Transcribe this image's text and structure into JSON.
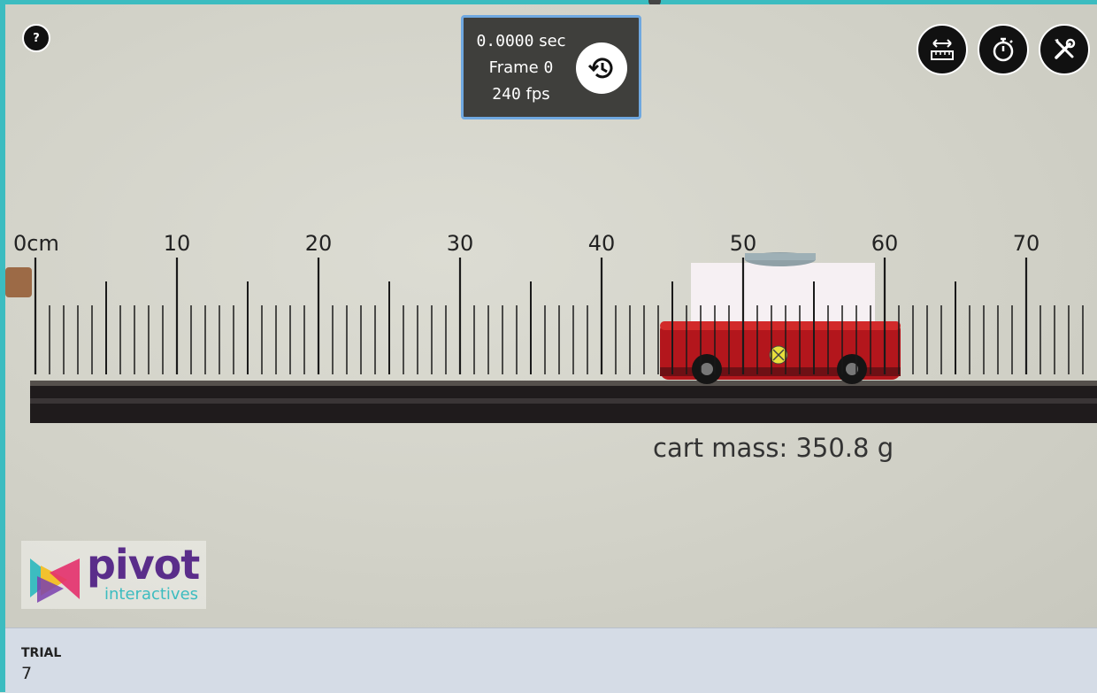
{
  "help": {
    "label": "?"
  },
  "timer": {
    "time": "0.0000",
    "time_unit": "sec",
    "frame_label": "Frame",
    "frame": "0",
    "fps": "240",
    "fps_unit": "fps",
    "reset_icon": "history-icon"
  },
  "toolbar": {
    "tools": [
      {
        "icon": "ruler-measure-icon"
      },
      {
        "icon": "stopwatch-icon"
      },
      {
        "icon": "tools-icon"
      }
    ]
  },
  "ruler": {
    "labels": [
      "0cm",
      "10",
      "20",
      "30",
      "40",
      "50",
      "60",
      "70"
    ]
  },
  "video": {
    "cart_mass": "cart mass: 350.8 g"
  },
  "logo": {
    "main": "pivot",
    "sub": "interactives"
  },
  "trial": {
    "label": "TRIAL",
    "value": "7"
  },
  "colors": {
    "accent": "#3cbcc0",
    "panel_border": "#6fa8e0",
    "cart_red": "#b3161c",
    "logo_purple": "#5a2d8a"
  }
}
